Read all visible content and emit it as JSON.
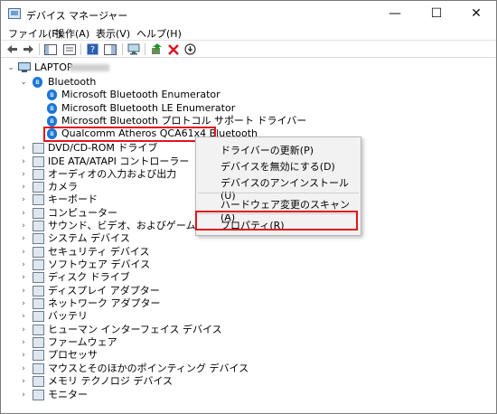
{
  "window": {
    "title": "デバイス マネージャー",
    "minimize": "—",
    "maximize": "☐",
    "close": "✕"
  },
  "menu": [
    "ファイル(F)",
    "操作(A)",
    "表示(V)",
    "ヘルプ(H)"
  ],
  "tree": {
    "root": "LAPTOP-",
    "bluetooth": {
      "label": "Bluetooth",
      "children": [
        "Microsoft Bluetooth Enumerator",
        "Microsoft Bluetooth LE Enumerator",
        "Microsoft Bluetooth プロトコル サポート ドライバー",
        "Qualcomm Atheros QCA61x4 Bluetooth"
      ]
    },
    "categories": [
      "DVD/CD-ROM ドライブ",
      "IDE ATA/ATAPI コントローラー",
      "オーディオの入力および出力",
      "カメラ",
      "キーボード",
      "コンピューター",
      "サウンド、ビデオ、およびゲーム コントローラー",
      "システム デバイス",
      "セキュリティ デバイス",
      "ソフトウェア デバイス",
      "ディスク ドライブ",
      "ディスプレイ アダプター",
      "ネットワーク アダプター",
      "バッテリ",
      "ヒューマン インターフェイス デバイス",
      "ファームウェア",
      "プロセッサ",
      "マウスとそのほかのポインティング デバイス",
      "メモリ テクノロジ デバイス",
      "モニター"
    ]
  },
  "context_menu": {
    "update_driver": "ドライバーの更新(P)",
    "disable_device": "デバイスを無効にする(D)",
    "uninstall_device": "デバイスのアンインストール(U)",
    "scan_hardware": "ハードウェア変更のスキャン(A)",
    "properties": "プロパティ(R)"
  },
  "colors": {
    "highlight_box": "#e0141f",
    "bluetooth": "#1a78d4"
  }
}
